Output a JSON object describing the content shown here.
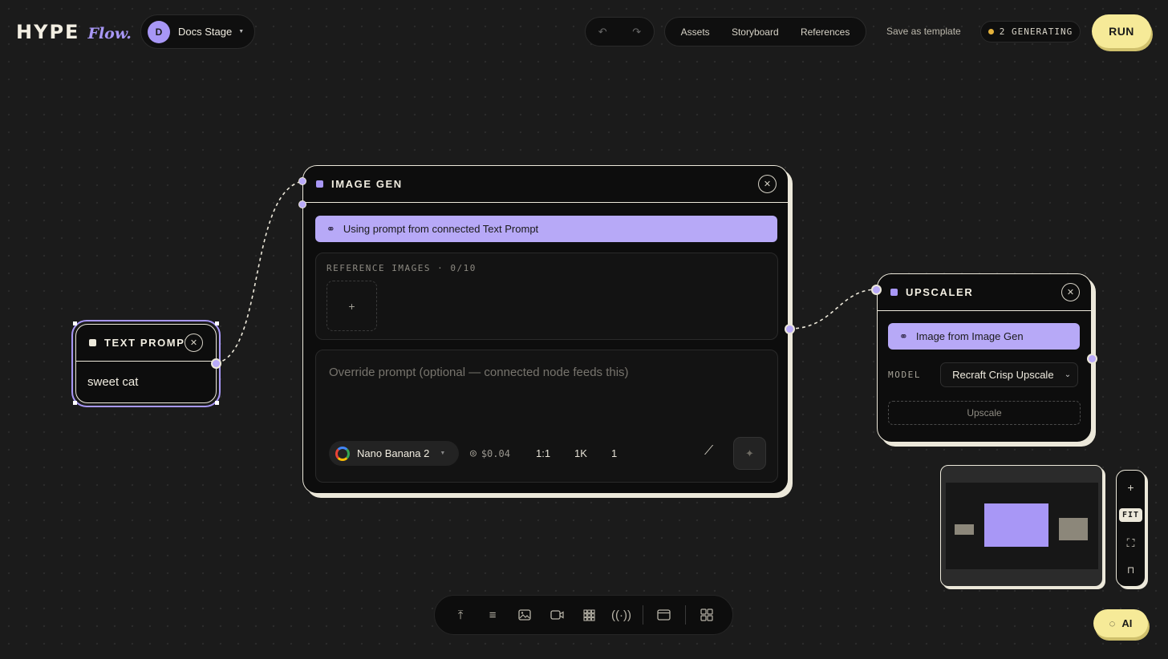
{
  "header": {
    "logo_main": "HYPE",
    "logo_accent": "Flow.",
    "project": {
      "avatar_initial": "D",
      "name": "Docs Stage"
    },
    "nav": [
      "Assets",
      "Storyboard",
      "References"
    ],
    "save_template": "Save as template",
    "generating_status": "2 GENERATING",
    "run_label": "RUN"
  },
  "nodes": {
    "text_prompt": {
      "title": "TEXT PROMPT",
      "content": "sweet cat"
    },
    "image_gen": {
      "title": "IMAGE GEN",
      "link_banner": "Using prompt from connected Text Prompt",
      "ref_label": "REFERENCE IMAGES · 0/10",
      "ref_add": "+",
      "prompt_placeholder": "Override prompt (optional — connected node feeds this)",
      "model": "Nano Banana 2",
      "cost": "$0.04",
      "aspect_ratio": "1:1",
      "resolution": "1K",
      "count": "1"
    },
    "upscaler": {
      "title": "UPSCALER",
      "link_banner": "Image from Image Gen",
      "model_label": "MODEL",
      "model_value": "Recraft Crisp Upscale",
      "upscale_label": "Upscale"
    }
  },
  "zoom_controls": {
    "plus": "+",
    "fit": "FIT"
  },
  "ai_button": "AI",
  "colors": {
    "accent": "#a897f6",
    "run": "#f6ea98",
    "card_border": "#ece8da",
    "canvas": "#1b1b1b"
  },
  "icons": [
    "undo-icon",
    "redo-icon",
    "link-icon",
    "close-icon",
    "google-icon",
    "coin-icon",
    "magic-wand-icon",
    "sparkle-icon",
    "upload-icon",
    "text-icon",
    "image-icon",
    "video-icon",
    "grid-icon",
    "audio-icon",
    "clapper-icon",
    "layout-icon",
    "chat-icon",
    "fullscreen-icon",
    "unlock-icon"
  ]
}
